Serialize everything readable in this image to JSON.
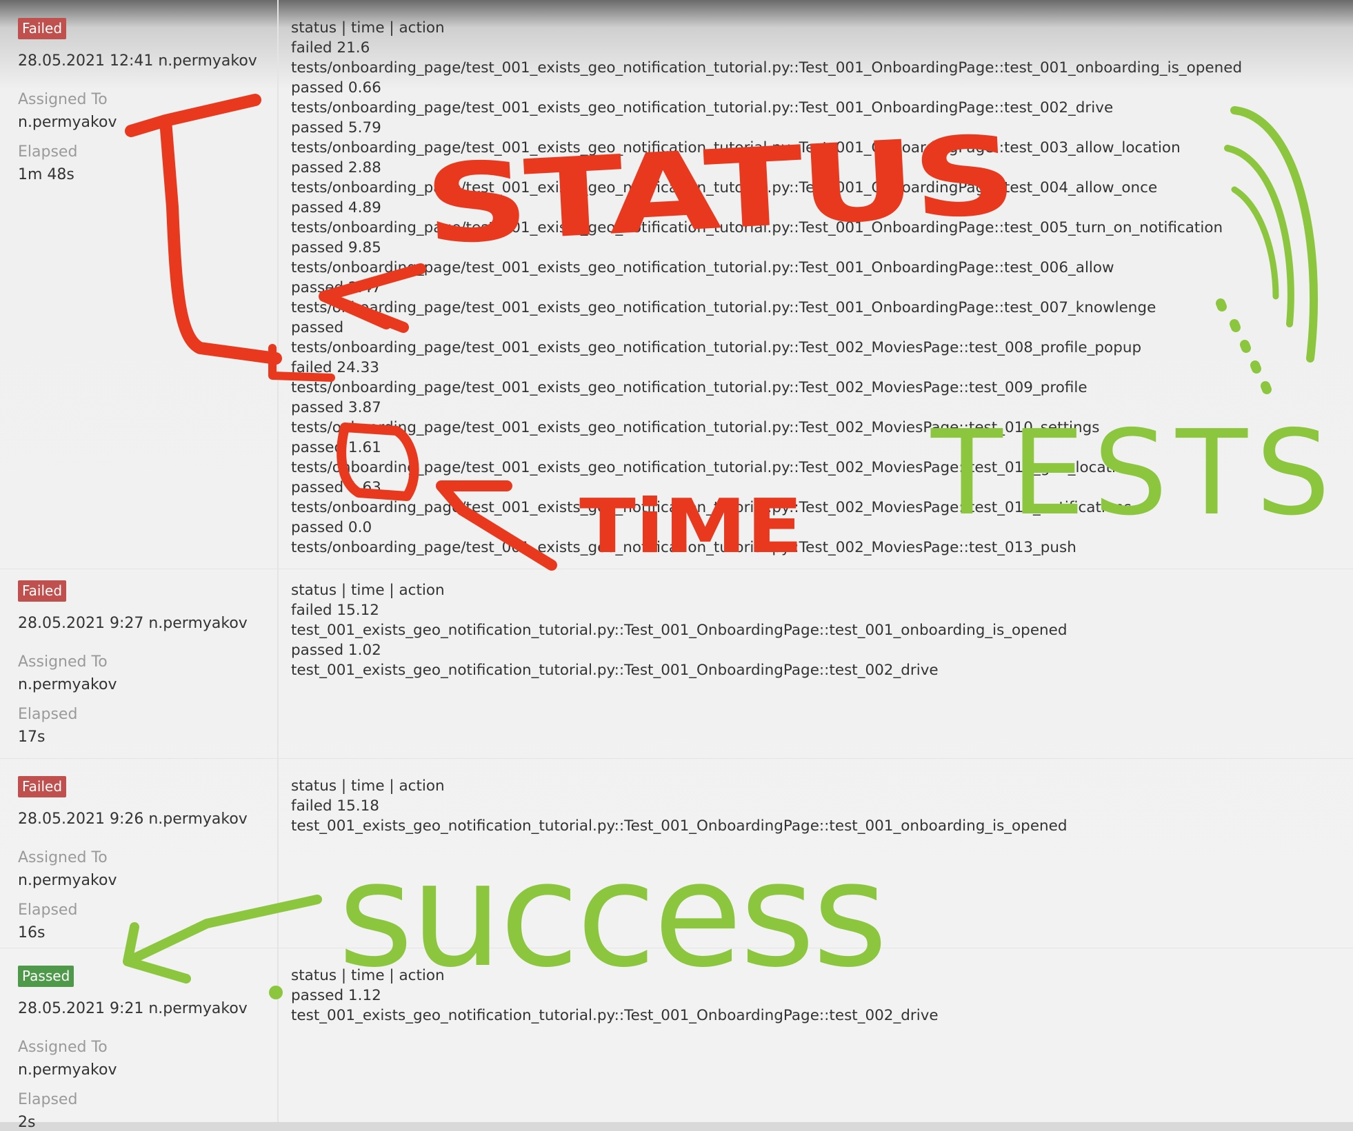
{
  "runs": [
    {
      "status": "Failed",
      "datetime": "28.05.2021 12:41 n.permyakov",
      "assigned_label": "Assigned To",
      "assigned_value": "n.permyakov",
      "elapsed_label": "Elapsed",
      "elapsed_value": "1m 48s",
      "log": [
        "status | time | action",
        "failed 21.6",
        "tests/onboarding_page/test_001_exists_geo_notification_tutorial.py::Test_001_OnboardingPage::test_001_onboarding_is_opened",
        "passed 0.66",
        "tests/onboarding_page/test_001_exists_geo_notification_tutorial.py::Test_001_OnboardingPage::test_002_drive",
        "passed 5.79",
        "tests/onboarding_page/test_001_exists_geo_notification_tutorial.py::Test_001_OnboardingPage::test_003_allow_location",
        "passed 2.88",
        "tests/onboarding_page/test_001_exists_geo_notification_tutorial.py::Test_001_OnboardingPage::test_004_allow_once",
        "passed 4.89",
        "tests/onboarding_page/test_001_exists_geo_notification_tutorial.py::Test_001_OnboardingPage::test_005_turn_on_notification",
        "passed 9.85",
        "tests/onboarding_page/test_001_exists_geo_notification_tutorial.py::Test_001_OnboardingPage::test_006_allow",
        "passed 2.47",
        "tests/onboarding_page/test_001_exists_geo_notification_tutorial.py::Test_001_OnboardingPage::test_007_knowlenge",
        "passed",
        "tests/onboarding_page/test_001_exists_geo_notification_tutorial.py::Test_002_MoviesPage::test_008_profile_popup",
        "failed 24.33",
        "tests/onboarding_page/test_001_exists_geo_notification_tutorial.py::Test_002_MoviesPage::test_009_profile",
        "passed 3.87",
        "tests/onboarding_page/test_001_exists_geo_notification_tutorial.py::Test_002_MoviesPage::test_010_settings",
        "passed 1.61",
        "tests/onboarding_page/test_001_exists_geo_notification_tutorial.py::Test_002_MoviesPage::test_011_geo_location",
        "passed 1.63",
        "tests/onboarding_page/test_001_exists_geo_notification_tutorial.py::Test_002_MoviesPage::test_012_notifications",
        "passed 0.0",
        "tests/onboarding_page/test_001_exists_geo_notification_tutorial.py::Test_002_MoviesPage::test_013_push"
      ]
    },
    {
      "status": "Failed",
      "datetime": "28.05.2021 9:27 n.permyakov",
      "assigned_label": "Assigned To",
      "assigned_value": "n.permyakov",
      "elapsed_label": "Elapsed",
      "elapsed_value": "17s",
      "log": [
        "status | time | action",
        "failed 15.12",
        "test_001_exists_geo_notification_tutorial.py::Test_001_OnboardingPage::test_001_onboarding_is_opened",
        "passed 1.02",
        "test_001_exists_geo_notification_tutorial.py::Test_001_OnboardingPage::test_002_drive"
      ]
    },
    {
      "status": "Failed",
      "datetime": "28.05.2021 9:26 n.permyakov",
      "assigned_label": "Assigned To",
      "assigned_value": "n.permyakov",
      "elapsed_label": "Elapsed",
      "elapsed_value": "16s",
      "log": [
        "status | time | action",
        "failed 15.18",
        "test_001_exists_geo_notification_tutorial.py::Test_001_OnboardingPage::test_001_onboarding_is_opened"
      ]
    },
    {
      "status": "Passed",
      "datetime": "28.05.2021 9:21 n.permyakov",
      "assigned_label": "Assigned To",
      "assigned_value": "n.permyakov",
      "elapsed_label": "Elapsed",
      "elapsed_value": "2s",
      "log": [
        "status | time | action",
        "passed 1.12",
        "test_001_exists_geo_notification_tutorial.py::Test_001_OnboardingPage::test_002_drive"
      ]
    }
  ],
  "annotations": {
    "status": "STATUS",
    "time": "TiME",
    "tests": "TESTS",
    "success": "success",
    "red_color": "#e8391f",
    "green_color": "#8cc63f"
  }
}
